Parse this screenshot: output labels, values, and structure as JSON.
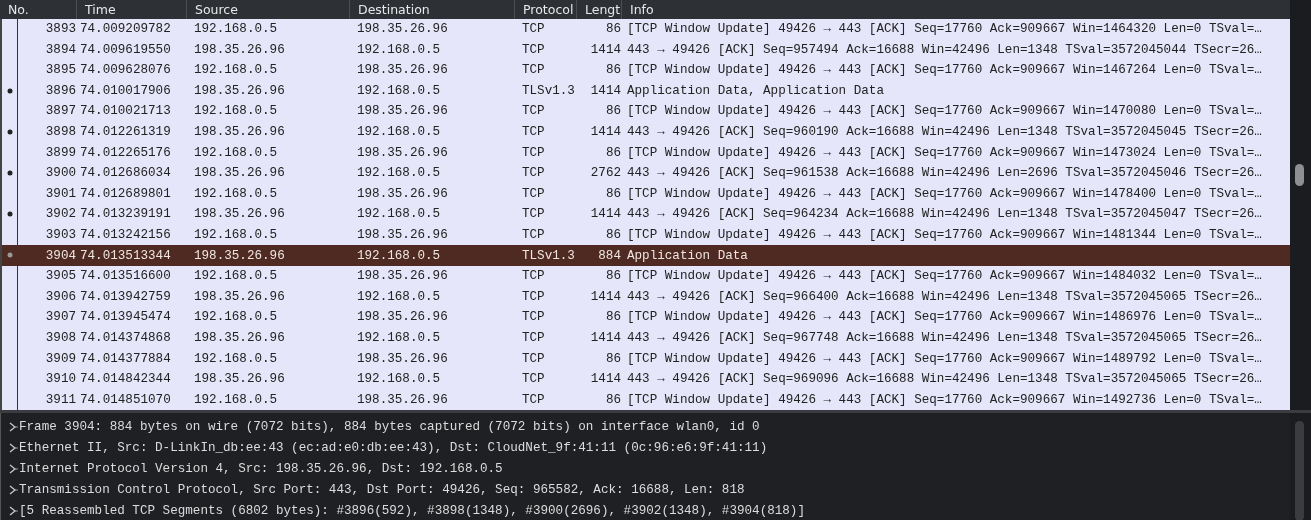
{
  "packet_list": {
    "columns": [
      "No.",
      "Time",
      "Source",
      "Destination",
      "Protocol",
      "Lengt",
      "Info"
    ],
    "rows": [
      {
        "no": "3893",
        "time": "74.009209782",
        "source": "192.168.0.5",
        "destination": "198.35.26.96",
        "protocol": "TCP",
        "length": "86",
        "info": "[TCP Window Update] 49426 → 443 [ACK] Seq=17760 Ack=909667 Win=1464320 Len=0 TSval=…",
        "related": false,
        "selected": false
      },
      {
        "no": "3894",
        "time": "74.009619550",
        "source": "198.35.26.96",
        "destination": "192.168.0.5",
        "protocol": "TCP",
        "length": "1414",
        "info": "443 → 49426 [ACK] Seq=957494 Ack=16688 Win=42496 Len=1348 TSval=3572045044 TSecr=26…",
        "related": false,
        "selected": false
      },
      {
        "no": "3895",
        "time": "74.009628076",
        "source": "192.168.0.5",
        "destination": "198.35.26.96",
        "protocol": "TCP",
        "length": "86",
        "info": "[TCP Window Update] 49426 → 443 [ACK] Seq=17760 Ack=909667 Win=1467264 Len=0 TSval=…",
        "related": false,
        "selected": false
      },
      {
        "no": "3896",
        "time": "74.010017906",
        "source": "198.35.26.96",
        "destination": "192.168.0.5",
        "protocol": "TLSv1.3",
        "length": "1414",
        "info": "Application Data, Application Data",
        "related": true,
        "selected": false
      },
      {
        "no": "3897",
        "time": "74.010021713",
        "source": "192.168.0.5",
        "destination": "198.35.26.96",
        "protocol": "TCP",
        "length": "86",
        "info": "[TCP Window Update] 49426 → 443 [ACK] Seq=17760 Ack=909667 Win=1470080 Len=0 TSval=…",
        "related": false,
        "selected": false
      },
      {
        "no": "3898",
        "time": "74.012261319",
        "source": "198.35.26.96",
        "destination": "192.168.0.5",
        "protocol": "TCP",
        "length": "1414",
        "info": "443 → 49426 [ACK] Seq=960190 Ack=16688 Win=42496 Len=1348 TSval=3572045045 TSecr=26…",
        "related": true,
        "selected": false
      },
      {
        "no": "3899",
        "time": "74.012265176",
        "source": "192.168.0.5",
        "destination": "198.35.26.96",
        "protocol": "TCP",
        "length": "86",
        "info": "[TCP Window Update] 49426 → 443 [ACK] Seq=17760 Ack=909667 Win=1473024 Len=0 TSval=…",
        "related": false,
        "selected": false
      },
      {
        "no": "3900",
        "time": "74.012686034",
        "source": "198.35.26.96",
        "destination": "192.168.0.5",
        "protocol": "TCP",
        "length": "2762",
        "info": "443 → 49426 [ACK] Seq=961538 Ack=16688 Win=42496 Len=2696 TSval=3572045046 TSecr=26…",
        "related": true,
        "selected": false
      },
      {
        "no": "3901",
        "time": "74.012689801",
        "source": "192.168.0.5",
        "destination": "198.35.26.96",
        "protocol": "TCP",
        "length": "86",
        "info": "[TCP Window Update] 49426 → 443 [ACK] Seq=17760 Ack=909667 Win=1478400 Len=0 TSval=…",
        "related": false,
        "selected": false
      },
      {
        "no": "3902",
        "time": "74.013239191",
        "source": "198.35.26.96",
        "destination": "192.168.0.5",
        "protocol": "TCP",
        "length": "1414",
        "info": "443 → 49426 [ACK] Seq=964234 Ack=16688 Win=42496 Len=1348 TSval=3572045047 TSecr=26…",
        "related": true,
        "selected": false
      },
      {
        "no": "3903",
        "time": "74.013242156",
        "source": "192.168.0.5",
        "destination": "198.35.26.96",
        "protocol": "TCP",
        "length": "86",
        "info": "[TCP Window Update] 49426 → 443 [ACK] Seq=17760 Ack=909667 Win=1481344 Len=0 TSval=…",
        "related": false,
        "selected": false
      },
      {
        "no": "3904",
        "time": "74.013513344",
        "source": "198.35.26.96",
        "destination": "192.168.0.5",
        "protocol": "TLSv1.3",
        "length": "884",
        "info": "Application Data",
        "related": false,
        "selected": true
      },
      {
        "no": "3905",
        "time": "74.013516600",
        "source": "192.168.0.5",
        "destination": "198.35.26.96",
        "protocol": "TCP",
        "length": "86",
        "info": "[TCP Window Update] 49426 → 443 [ACK] Seq=17760 Ack=909667 Win=1484032 Len=0 TSval=…",
        "related": false,
        "selected": false
      },
      {
        "no": "3906",
        "time": "74.013942759",
        "source": "198.35.26.96",
        "destination": "192.168.0.5",
        "protocol": "TCP",
        "length": "1414",
        "info": "443 → 49426 [ACK] Seq=966400 Ack=16688 Win=42496 Len=1348 TSval=3572045065 TSecr=26…",
        "related": false,
        "selected": false
      },
      {
        "no": "3907",
        "time": "74.013945474",
        "source": "192.168.0.5",
        "destination": "198.35.26.96",
        "protocol": "TCP",
        "length": "86",
        "info": "[TCP Window Update] 49426 → 443 [ACK] Seq=17760 Ack=909667 Win=1486976 Len=0 TSval=…",
        "related": false,
        "selected": false
      },
      {
        "no": "3908",
        "time": "74.014374868",
        "source": "198.35.26.96",
        "destination": "192.168.0.5",
        "protocol": "TCP",
        "length": "1414",
        "info": "443 → 49426 [ACK] Seq=967748 Ack=16688 Win=42496 Len=1348 TSval=3572045065 TSecr=26…",
        "related": false,
        "selected": false
      },
      {
        "no": "3909",
        "time": "74.014377884",
        "source": "192.168.0.5",
        "destination": "198.35.26.96",
        "protocol": "TCP",
        "length": "86",
        "info": "[TCP Window Update] 49426 → 443 [ACK] Seq=17760 Ack=909667 Win=1489792 Len=0 TSval=…",
        "related": false,
        "selected": false
      },
      {
        "no": "3910",
        "time": "74.014842344",
        "source": "198.35.26.96",
        "destination": "192.168.0.5",
        "protocol": "TCP",
        "length": "1414",
        "info": "443 → 49426 [ACK] Seq=969096 Ack=16688 Win=42496 Len=1348 TSval=3572045065 TSecr=26…",
        "related": false,
        "selected": false
      },
      {
        "no": "3911",
        "time": "74.014851070",
        "source": "192.168.0.5",
        "destination": "198.35.26.96",
        "protocol": "TCP",
        "length": "86",
        "info": "[TCP Window Update] 49426 → 443 [ACK] Seq=17760 Ack=909667 Win=1492736 Len=0 TSval=…",
        "related": false,
        "selected": false
      }
    ]
  },
  "packet_details": [
    {
      "text": "Frame 3904: 884 bytes on wire (7072 bits), 884 bytes captured (7072 bits) on interface wlan0, id 0",
      "expanded": false
    },
    {
      "text": "Ethernet II, Src: D-LinkIn_db:ee:43 (ec:ad:e0:db:ee:43), Dst: CloudNet_9f:41:11 (0c:96:e6:9f:41:11)",
      "expanded": false
    },
    {
      "text": "Internet Protocol Version 4, Src: 198.35.26.96, Dst: 192.168.0.5",
      "expanded": false
    },
    {
      "text": "Transmission Control Protocol, Src Port: 443, Dst Port: 49426, Seq: 965582, Ack: 16688, Len: 818",
      "expanded": false
    },
    {
      "text": "[5 Reassembled TCP Segments (6802 bytes): #3896(592), #3898(1348), #3900(2696), #3902(1348), #3904(818)]",
      "expanded": false
    }
  ]
}
